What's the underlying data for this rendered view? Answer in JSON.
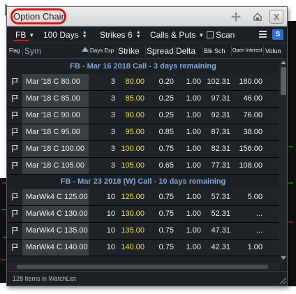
{
  "window": {
    "title": "Option Chain"
  },
  "toolbar": {
    "symbol": "FB",
    "days": "100 Days",
    "strikes": "Strikes 6",
    "type": "Calls & Puts",
    "scan_label": "Scan",
    "s_badge": "S"
  },
  "columns": {
    "flag": "Flag",
    "sym": "Sym",
    "days": "Days Exp",
    "strike": "Strike",
    "spread": "Spread",
    "delta": "Delta",
    "blk": "Blk Sch",
    "oi": "Open Interest",
    "vol": "Volume"
  },
  "groups": [
    {
      "title": "FB - Mar 16 2018 Call - 3 days remaining",
      "rows": [
        {
          "sym": "Mar '18 C 80.00",
          "days": "3",
          "strike": "80.00",
          "spread": "0.20",
          "delta": "1.00",
          "blk": "102.31",
          "oi": "180.00"
        },
        {
          "sym": "Mar '18 C 85.00",
          "days": "3",
          "strike": "85.00",
          "spread": "0.25",
          "delta": "1.00",
          "blk": "97.31",
          "oi": "46.00"
        },
        {
          "sym": "Mar '18 C 90.00",
          "days": "3",
          "strike": "90.00",
          "spread": "0.25",
          "delta": "1.00",
          "blk": "92.31",
          "oi": "76.00"
        },
        {
          "sym": "Mar '18 C 95.00",
          "days": "3",
          "strike": "95.00",
          "spread": "0.85",
          "delta": "1.00",
          "blk": "87.31",
          "oi": "38.00"
        },
        {
          "sym": "Mar '18 C 100.00",
          "days": "3",
          "strike": "100.00",
          "spread": "0.75",
          "delta": "1.00",
          "blk": "82.31",
          "oi": "156.00"
        },
        {
          "sym": "Mar '18 C 105.00",
          "days": "3",
          "strike": "105.00",
          "spread": "0.65",
          "delta": "1.00",
          "blk": "77.31",
          "oi": "108.00"
        }
      ]
    },
    {
      "title": "FB - Mar 23 2018 (W) Call - 10 days remaining",
      "rows": [
        {
          "sym": "MarWk4 C 125.00",
          "days": "10",
          "strike": "125.00",
          "spread": "0.75",
          "delta": "1.00",
          "blk": "57.31",
          "oi": "5.00"
        },
        {
          "sym": "MarWk4 C 130.00",
          "days": "10",
          "strike": "130.00",
          "spread": "0.75",
          "delta": "1.00",
          "blk": "52.31",
          "oi": "..."
        },
        {
          "sym": "MarWk4 C 135.00",
          "days": "10",
          "strike": "135.00",
          "spread": "0.75",
          "delta": "1.00",
          "blk": "47.31",
          "oi": "..."
        },
        {
          "sym": "MarWk4 C 140.00",
          "days": "10",
          "strike": "140.00",
          "spread": "0.75",
          "delta": "1.00",
          "blk": "42.31",
          "oi": "1.00"
        }
      ]
    }
  ],
  "status": {
    "text": "128 Items in WatchList"
  },
  "colors": {
    "accent": "#e01010",
    "group_title": "#7ea7d4",
    "strike": "#f0e34a",
    "s_badge": "#2f6fd0"
  }
}
